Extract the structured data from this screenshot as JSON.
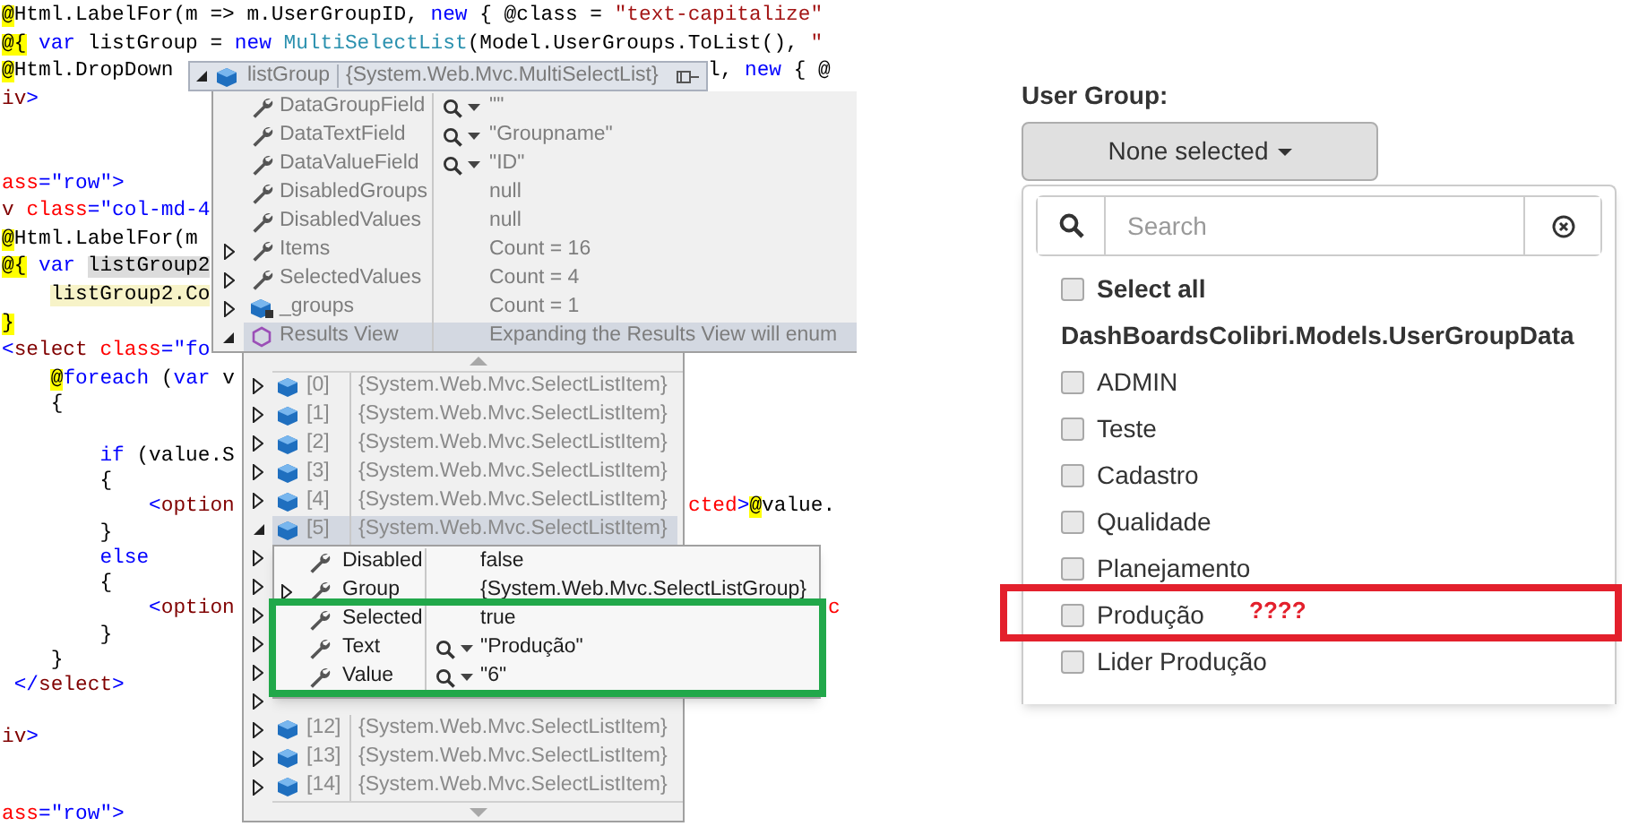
{
  "editor": {
    "lines": [
      {
        "kind": "code",
        "segments": [
          {
            "kind": "razor",
            "text": "@"
          },
          {
            "kind": "plain",
            "text": "Html.LabelFor(m => m.UserGroupID, "
          },
          {
            "kind": "keyword",
            "text": "new"
          },
          {
            "kind": "plain",
            "text": " { @class = "
          },
          {
            "kind": "string",
            "text": "\"text-capitalize\""
          }
        ]
      },
      {
        "kind": "code",
        "segments": [
          {
            "kind": "razor",
            "text": "@{"
          },
          {
            "kind": "keyword",
            "text": " var"
          },
          {
            "kind": "plain",
            "text": " listGroup = "
          },
          {
            "kind": "keyword",
            "text": "new"
          },
          {
            "kind": "type",
            "text": " MultiSelectList"
          },
          {
            "kind": "plain",
            "text": "(Model.UserGroups.ToList(), "
          },
          {
            "kind": "string",
            "text": "\""
          }
        ]
      },
      {
        "kind": "code",
        "segments": [
          {
            "kind": "razor",
            "text": "@"
          },
          {
            "kind": "plain",
            "text": "Html.DropDown"
          }
        ],
        "after": [
          {
            "kind": "plain",
            "text": "l, "
          },
          {
            "kind": "keyword",
            "text": "new"
          },
          {
            "kind": "plain",
            "text": " { @"
          }
        ]
      },
      {
        "kind": "code",
        "segments": [
          {
            "kind": "tag",
            "text": "iv"
          },
          {
            "kind": "delim",
            "text": ">"
          }
        ]
      },
      {
        "kind": "blank"
      },
      {
        "kind": "blank"
      },
      {
        "kind": "code",
        "segments": [
          {
            "kind": "attr",
            "text": "ass"
          },
          {
            "kind": "delim",
            "text": "=\"row\">"
          }
        ]
      },
      {
        "kind": "code",
        "segments": [
          {
            "kind": "tag",
            "text": "v"
          },
          {
            "kind": "attr",
            "text": " class"
          },
          {
            "kind": "delim",
            "text": "=\"col-md-4"
          }
        ]
      },
      {
        "kind": "code",
        "segments": [
          {
            "kind": "razor",
            "text": "@"
          },
          {
            "kind": "plain",
            "text": "Html.LabelFor(m"
          }
        ]
      },
      {
        "kind": "code",
        "segments": [
          {
            "kind": "razor",
            "text": "@{"
          },
          {
            "kind": "keyword",
            "text": " var"
          },
          {
            "kind": "ref",
            "text": " listGroup2"
          }
        ]
      },
      {
        "kind": "code",
        "segments": [
          {
            "kind": "mark",
            "text": "    listGroup2.Co"
          }
        ]
      },
      {
        "kind": "code",
        "segments": [
          {
            "kind": "razor",
            "text": "}"
          }
        ]
      },
      {
        "kind": "code",
        "segments": [
          {
            "kind": "delim",
            "text": "<"
          },
          {
            "kind": "tag",
            "text": "select"
          },
          {
            "kind": "attr",
            "text": " class"
          },
          {
            "kind": "delim",
            "text": "=\"fo"
          }
        ]
      },
      {
        "kind": "code",
        "segments": [
          {
            "kind": "razor",
            "text": "    @"
          },
          {
            "kind": "keyword",
            "text": "foreach"
          },
          {
            "kind": "plain",
            "text": " ("
          },
          {
            "kind": "keyword",
            "text": "var"
          },
          {
            "kind": "plain",
            "text": " v"
          }
        ]
      },
      {
        "kind": "code",
        "segments": [
          {
            "kind": "plain",
            "text": "    {"
          }
        ]
      },
      {
        "kind": "blank"
      },
      {
        "kind": "code",
        "segments": [
          {
            "kind": "keyword",
            "text": "        if"
          },
          {
            "kind": "plain",
            "text": " (value.S"
          }
        ]
      },
      {
        "kind": "code",
        "segments": [
          {
            "kind": "plain",
            "text": "        {"
          }
        ]
      },
      {
        "kind": "code",
        "segments": [
          {
            "kind": "delim",
            "text": "            <"
          },
          {
            "kind": "tag",
            "text": "option"
          }
        ],
        "after": [
          {
            "kind": "attr",
            "text": "cted"
          },
          {
            "kind": "delim",
            "text": ">"
          },
          {
            "kind": "razor",
            "text": "@"
          },
          {
            "kind": "plain",
            "text": "value."
          }
        ]
      },
      {
        "kind": "code",
        "segments": [
          {
            "kind": "plain",
            "text": "        }"
          }
        ]
      },
      {
        "kind": "code",
        "segments": [
          {
            "kind": "keyword",
            "text": "        else"
          }
        ]
      },
      {
        "kind": "code",
        "segments": [
          {
            "kind": "plain",
            "text": "        {"
          }
        ]
      },
      {
        "kind": "code",
        "segments": [
          {
            "kind": "delim",
            "text": "            <"
          },
          {
            "kind": "tag",
            "text": "option"
          }
        ],
        "after": [
          {
            "kind": "attr",
            "text": "c"
          }
        ]
      },
      {
        "kind": "code",
        "segments": [
          {
            "kind": "plain",
            "text": "        }"
          }
        ]
      },
      {
        "kind": "code",
        "segments": [
          {
            "kind": "plain",
            "text": "    }"
          }
        ]
      },
      {
        "kind": "code",
        "segments": [
          {
            "kind": "delim",
            "text": " </"
          },
          {
            "kind": "tag",
            "text": "select"
          },
          {
            "kind": "delim",
            "text": ">"
          }
        ]
      },
      {
        "kind": "blank"
      },
      {
        "kind": "code",
        "segments": [
          {
            "kind": "tag",
            "text": "iv"
          },
          {
            "kind": "delim",
            "text": ">"
          }
        ]
      },
      {
        "kind": "blank"
      },
      {
        "kind": "blank"
      },
      {
        "kind": "code",
        "segments": [
          {
            "kind": "attr",
            "text": "ass"
          },
          {
            "kind": "delim",
            "text": "=\"row\">"
          }
        ]
      }
    ]
  },
  "datatip": {
    "expanded": true,
    "name": "listGroup",
    "type": "{System.Web.Mvc.MultiSelectList}",
    "members": [
      {
        "kind": "property",
        "name": "DataGroupField",
        "visualizer": true,
        "value": "\"\"",
        "selected": false
      },
      {
        "kind": "property",
        "name": "DataTextField",
        "visualizer": true,
        "value": "\"Groupname\"",
        "selected": false
      },
      {
        "kind": "property",
        "name": "DataValueField",
        "visualizer": true,
        "value": "\"ID\"",
        "selected": false
      },
      {
        "kind": "property",
        "name": "DisabledGroups",
        "visualizer": false,
        "value": "null",
        "selected": false
      },
      {
        "kind": "property",
        "name": "DisabledValues",
        "visualizer": false,
        "value": "null",
        "selected": false
      },
      {
        "expanded": false,
        "kind": "property",
        "name": "Items",
        "visualizer": false,
        "value": "Count = 16",
        "selected": false
      },
      {
        "expanded": false,
        "kind": "property",
        "name": "SelectedValues",
        "visualizer": false,
        "value": "Count = 4",
        "selected": false
      },
      {
        "expanded": false,
        "kind": "private_field",
        "name": "_groups",
        "visualizer": false,
        "value": "Count = 1",
        "selected": false
      },
      {
        "expanded": true,
        "kind": "results",
        "name": "Results View",
        "visualizer": false,
        "value": "Expanding the Results View will enum",
        "selected": true
      }
    ]
  },
  "results_view": {
    "items": [
      {
        "expanded": false,
        "index": "[0]",
        "value": "{System.Web.Mvc.SelectListItem}",
        "selected": false
      },
      {
        "expanded": false,
        "index": "[1]",
        "value": "{System.Web.Mvc.SelectListItem}",
        "selected": false
      },
      {
        "expanded": false,
        "index": "[2]",
        "value": "{System.Web.Mvc.SelectListItem}",
        "selected": false
      },
      {
        "expanded": false,
        "index": "[3]",
        "value": "{System.Web.Mvc.SelectListItem}",
        "selected": false
      },
      {
        "expanded": false,
        "index": "[4]",
        "value": "{System.Web.Mvc.SelectListItem}",
        "selected": false
      },
      {
        "expanded": true,
        "index": "[5]",
        "value": "{System.Web.Mvc.SelectListItem}",
        "selected": true
      },
      {
        "expanded": false
      },
      {
        "expanded": false
      },
      {
        "expanded": false
      },
      {
        "expanded": false
      },
      {
        "expanded": false
      },
      {
        "expanded": false
      },
      {
        "expanded": false,
        "index": "[12]",
        "value": "{System.Web.Mvc.SelectListItem}",
        "selected": false
      },
      {
        "expanded": false,
        "index": "[13]",
        "value": "{System.Web.Mvc.SelectListItem}",
        "selected": false
      },
      {
        "expanded": false,
        "index": "[14]",
        "value": "{System.Web.Mvc.SelectListItem}",
        "selected": false
      }
    ]
  },
  "item_detail": {
    "members": [
      {
        "kind": "value",
        "name": "Disabled",
        "value": "false"
      },
      {
        "kind": "value",
        "expanded": false,
        "name": "Group",
        "value": "{System.Web.Mvc.SelectListGroup}"
      },
      {
        "kind": "value",
        "name": "Selected",
        "value": "true"
      },
      {
        "kind": "string",
        "name": "Text",
        "value": "\"Produção\""
      },
      {
        "kind": "string",
        "name": "Value",
        "value": "\"6\""
      }
    ]
  },
  "user_group": {
    "label": "User Group:",
    "button": "None selected",
    "search": {
      "placeholder": "Search"
    },
    "items": [
      {
        "kind": "select_all",
        "label": "Select all",
        "checked": false
      },
      {
        "kind": "group",
        "label": "DashBoardsColibri.Models.UserGroupData"
      },
      {
        "kind": "option",
        "label": "ADMIN",
        "checked": false
      },
      {
        "kind": "option",
        "label": "Teste",
        "checked": false
      },
      {
        "kind": "option",
        "label": "Cadastro",
        "checked": false
      },
      {
        "kind": "option",
        "label": "Qualidade",
        "checked": false
      },
      {
        "kind": "option",
        "label": "Planejamento",
        "checked": false
      },
      {
        "kind": "option",
        "label": "Produção",
        "checked": false
      },
      {
        "kind": "option",
        "label": "Lider Produção",
        "checked": false
      }
    ]
  },
  "annotations": [
    {
      "color": "#21a84a"
    },
    {
      "color": "#e3202c",
      "note": "????"
    }
  ]
}
